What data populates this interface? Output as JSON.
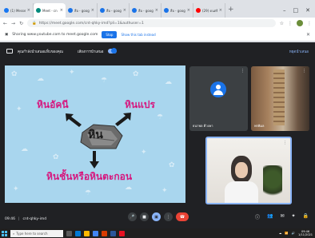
{
  "browser": {
    "tabs": [
      {
        "label": "(1) Messenger",
        "color": "#1877f2",
        "active": false
      },
      {
        "label": "Meet - cn",
        "color": "#00897b",
        "active": true
      },
      {
        "label": "สื่อ - google",
        "color": "#1a73e8",
        "active": false
      },
      {
        "label": "สื่อ - google",
        "color": "#1a73e8",
        "active": false
      },
      {
        "label": "สื่อ - google",
        "color": "#1a73e8",
        "active": false
      },
      {
        "label": "สื่อ - google",
        "color": "#1a73e8",
        "active": false
      },
      {
        "label": "(29) ดนตรี",
        "color": "#ff0000",
        "active": false
      }
    ],
    "new_tab": "+",
    "url": "https://meet.google.com/cnt-qhky-imd?pli=1&authuser=1"
  },
  "share_bar": {
    "message": "Sharing www.youtube.com to meet.google.com",
    "stop_label": "Stop",
    "hide_label": "Show this tab instead"
  },
  "meet": {
    "presenting_label": "คุณกำลังนำเสนอแท็บของคุณ",
    "share_audio_label": "เสียงการนำเสนอ",
    "top_right_label": "หยุดนำเสนอ",
    "slide": {
      "center": "หิน",
      "top_left": "หินอัคนี",
      "top_right": "หินแปร",
      "bottom": "หินชั้นหรือหินตะกอน"
    },
    "participants": [
      {
        "name": "ธนาพล ดีวงษา",
        "type": "avatar"
      },
      {
        "name": "พรพิมล",
        "type": "video"
      },
      {
        "name": "",
        "type": "self-video"
      }
    ],
    "time": "09:46",
    "meeting_code": "cnt-qhky-imd"
  },
  "taskbar": {
    "search_placeholder": "Type here to search",
    "time": "09:46",
    "date": "1/11/2021"
  }
}
